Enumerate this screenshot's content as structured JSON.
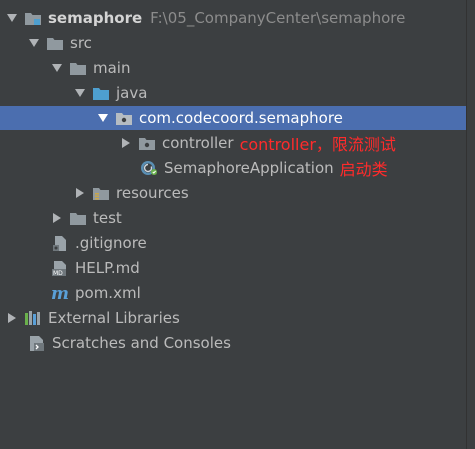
{
  "tree": {
    "project": {
      "name": "semaphore",
      "path": "F:\\05_CompanyCenter\\semaphore"
    },
    "src": "src",
    "main": "main",
    "java": "java",
    "package": "com.codecoord.semaphore",
    "controller": {
      "label": "controller",
      "note": "controller，限流测试"
    },
    "application": {
      "label": "SemaphoreApplication",
      "note": "启动类"
    },
    "resources": "resources",
    "test": "test",
    "gitignore": ".gitignore",
    "help": "HELP.md",
    "pom": "pom.xml",
    "external_libraries": "External Libraries",
    "scratches": "Scratches and Consoles"
  },
  "colors": {
    "background": "#3c3f41",
    "selection": "#4b6eaf",
    "folder": "#90999f",
    "source_folder": "#4e9fcf",
    "annotation": "#ff2b2b"
  },
  "icons": {
    "project": "module-folder-icon",
    "folder": "folder-icon",
    "source": "source-folder-icon",
    "package": "package-icon",
    "spring_boot_class": "spring-boot-class-icon",
    "resources": "resources-folder-icon",
    "gitignore": "gitignore-file-icon",
    "markdown": "markdown-file-icon",
    "maven": "maven-pom-icon",
    "libraries": "libraries-icon",
    "scratches": "scratches-icon"
  }
}
